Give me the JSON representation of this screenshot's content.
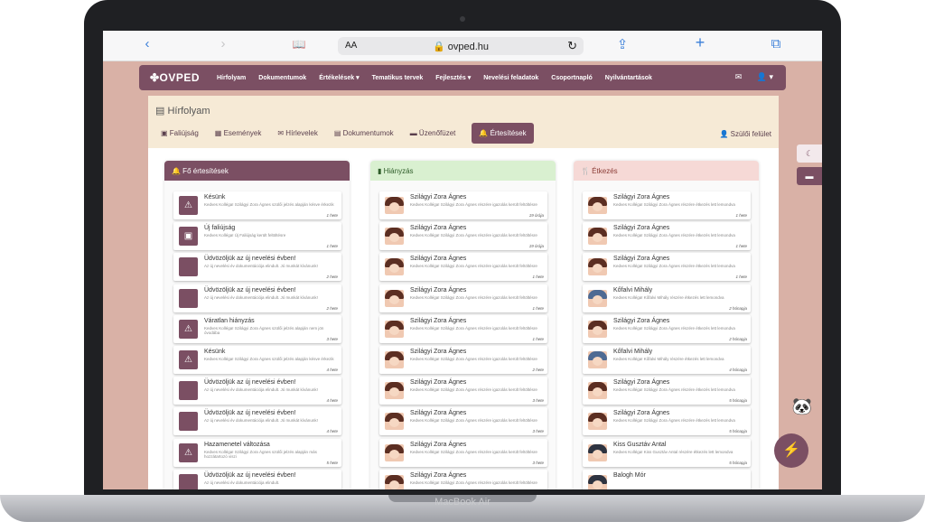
{
  "device": {
    "label": "MacBook Air"
  },
  "browser": {
    "back": "‹",
    "forward": "›",
    "aa": "AA",
    "url": "🔒 ovped.hu",
    "reload": "↻",
    "share": "⇪",
    "add": "+",
    "tabs": "⧉",
    "book": "📖"
  },
  "navbar": {
    "logo": "✤OVPED",
    "links": [
      "Hírfolyam",
      "Dokumentumok",
      "Értékelések ▾",
      "Tematikus tervek",
      "Fejlesztés ▾",
      "Nevelési feladatok",
      "Csoportnapló",
      "Nyilvántartások"
    ],
    "mail_icon": "✉",
    "user_icon": "👤 ▾"
  },
  "panel": {
    "title": "▤ Hírfolyam",
    "tabs": [
      "▣ Faliújság",
      "▦ Események",
      "✉ Hírlevelek",
      "▤ Dokumentumok",
      "▬ Üzenőfüzet",
      "🔔 Értesítések"
    ],
    "parent_link": "👤 Szülői felület"
  },
  "colors": {
    "accent": "#7b4f63",
    "col1": "#7b4f63",
    "col2": "#d9f0d0",
    "col3": "#f6d9d6"
  },
  "columns": [
    {
      "title": "🔔 Fő értesítések",
      "items": [
        {
          "icon": "⚠",
          "title": "Késünk",
          "desc": "Kedves Kolléga! Szilágyi Zora Ágnes szülői jelzés alapján késve érkezik",
          "time": "1 hete"
        },
        {
          "icon": "▣",
          "title": "Új faliújság",
          "desc": "Kedves Kolléga! Új Faliújság került feltöltésre",
          "time": "1 hete"
        },
        {
          "icon": "",
          "title": "Üdvözöljük az új nevelési évben!",
          "desc": "Az új nevelési év dokumentációja elindult. Jó munkát kívánunk!",
          "time": "2 hete"
        },
        {
          "icon": "",
          "title": "Üdvözöljük az új nevelési évben!",
          "desc": "Az új nevelési év dokumentációja elindult. Jó munkát kívánunk!",
          "time": "2 hete"
        },
        {
          "icon": "⚠",
          "title": "Váratlan hiányzás",
          "desc": "Kedves Kolléga! Szilágyi Zora Ágnes szülői jelzés alapján nem jön óvodába",
          "time": "3 hete"
        },
        {
          "icon": "⚠",
          "title": "Késünk",
          "desc": "Kedves Kolléga! Szilágyi Zora Ágnes szülői jelzés alapján késve érkezik",
          "time": "4 hete"
        },
        {
          "icon": "",
          "title": "Üdvözöljük az új nevelési évben!",
          "desc": "Az új nevelési év dokumentációja elindult. Jó munkát kívánunk!",
          "time": "4 hete"
        },
        {
          "icon": "",
          "title": "Üdvözöljük az új nevelési évben!",
          "desc": "Az új nevelési év dokumentációja elindult. Jó munkát kívánunk!",
          "time": "4 hete"
        },
        {
          "icon": "⚠",
          "title": "Hazamenetel változása",
          "desc": "Kedves Kolléga! Szilágyi Zora Ágnes szülői jelzés alapján más hozzátartozó viszi",
          "time": "5 hete"
        },
        {
          "icon": "",
          "title": "Üdvözöljük az új nevelési évben!",
          "desc": "Az új nevelési év dokumentációja elindult.",
          "time": ""
        }
      ]
    },
    {
      "title": "▮ Hiányzás",
      "items": [
        {
          "hair": "",
          "title": "Szilágyi Zora Ágnes",
          "desc": "Kedves Kolléga! Szilágyi Zora Ágnes részére igazolás került feltöltésre",
          "time": "19 órája"
        },
        {
          "hair": "",
          "title": "Szilágyi Zora Ágnes",
          "desc": "Kedves Kolléga! Szilágyi Zora Ágnes részére igazolás került feltöltésre",
          "time": "19 órája"
        },
        {
          "hair": "",
          "title": "Szilágyi Zora Ágnes",
          "desc": "Kedves Kolléga! Szilágyi Zora Ágnes részére igazolás került feltöltésre",
          "time": "1 hete"
        },
        {
          "hair": "",
          "title": "Szilágyi Zora Ágnes",
          "desc": "Kedves Kolléga! Szilágyi Zora Ágnes részére igazolás került feltöltésre",
          "time": "1 hete"
        },
        {
          "hair": "",
          "title": "Szilágyi Zora Ágnes",
          "desc": "Kedves Kolléga! Szilágyi Zora Ágnes részére igazolás került feltöltésre",
          "time": "1 hete"
        },
        {
          "hair": "",
          "title": "Szilágyi Zora Ágnes",
          "desc": "Kedves Kolléga! Szilágyi Zora Ágnes részére igazolás került feltöltésre",
          "time": "2 hete"
        },
        {
          "hair": "",
          "title": "Szilágyi Zora Ágnes",
          "desc": "Kedves Kolléga! Szilágyi Zora Ágnes részére igazolás került feltöltésre",
          "time": "3 hete"
        },
        {
          "hair": "",
          "title": "Szilágyi Zora Ágnes",
          "desc": "Kedves Kolléga! Szilágyi Zora Ágnes részére igazolás került feltöltésre",
          "time": "3 hete"
        },
        {
          "hair": "",
          "title": "Szilágyi Zora Ágnes",
          "desc": "Kedves Kolléga! Szilágyi Zora Ágnes részére igazolás került feltöltésre",
          "time": "3 hete"
        },
        {
          "hair": "",
          "title": "Szilágyi Zora Ágnes",
          "desc": "Kedves Kolléga! Szilágyi Zora Ágnes részére igazolás került feltöltésre",
          "time": ""
        }
      ]
    },
    {
      "title": "🍴 Étkezés",
      "items": [
        {
          "hair": "",
          "title": "Szilágyi Zora Ágnes",
          "desc": "Kedves Kolléga! Szilágyi Zora Ágnes részére étkezés lett lemondva",
          "time": "1 hete"
        },
        {
          "hair": "",
          "title": "Szilágyi Zora Ágnes",
          "desc": "Kedves Kolléga! Szilágyi Zora Ágnes részére étkezés lett lemondva",
          "time": "1 hete"
        },
        {
          "hair": "",
          "title": "Szilágyi Zora Ágnes",
          "desc": "Kedves Kolléga! Szilágyi Zora Ágnes részére étkezés lett lemondva",
          "time": "1 hete"
        },
        {
          "hair": "blue",
          "title": "Kőfalvi Mihály",
          "desc": "Kedves Kolléga! Kőfalvi Mihály részére étkezés lett lemondva",
          "time": "2 hónapja"
        },
        {
          "hair": "",
          "title": "Szilágyi Zora Ágnes",
          "desc": "Kedves Kolléga! Szilágyi Zora Ágnes részére étkezés lett lemondva",
          "time": "2 hónapja"
        },
        {
          "hair": "blue",
          "title": "Kőfalvi Mihály",
          "desc": "Kedves Kolléga! Kőfalvi Mihály részére étkezés lett lemondva",
          "time": "4 hónapja"
        },
        {
          "hair": "",
          "title": "Szilágyi Zora Ágnes",
          "desc": "Kedves Kolléga! Szilágyi Zora Ágnes részére étkezés lett lemondva",
          "time": "5 hónapja"
        },
        {
          "hair": "",
          "title": "Szilágyi Zora Ágnes",
          "desc": "Kedves Kolléga! Szilágyi Zora Ágnes részére étkezés lett lemondva",
          "time": "5 hónapja"
        },
        {
          "hair": "dark",
          "title": "Kiss Gusztáv Antal",
          "desc": "Kedves Kolléga! Kiss Gusztáv Antal részére étkezés lett lemondva",
          "time": "5 hónapja"
        },
        {
          "hair": "dark",
          "title": "Balogh Mór",
          "desc": "",
          "time": ""
        }
      ]
    }
  ],
  "side": {
    "moon": "☾",
    "chat": "▬",
    "bot": "🐼",
    "messenger": "⚡"
  }
}
